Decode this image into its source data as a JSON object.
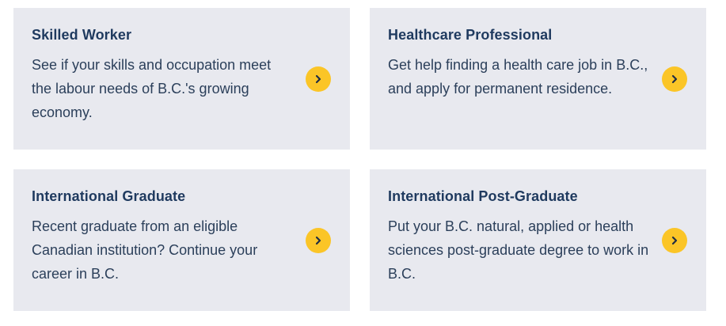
{
  "pathways": [
    {
      "title": "Skilled Worker",
      "description": "See if your skills and occupation meet the labour needs of B.C.'s growing economy.",
      "arrow_icon": "chevron-right-icon"
    },
    {
      "title": "Healthcare Professional",
      "description": "Get help finding a health care job in B.C., and apply for permanent residence.",
      "arrow_icon": "chevron-right-icon"
    },
    {
      "title": "International Graduate",
      "description": "Recent graduate from an eligible Canadian institution? Continue your career in B.C.",
      "arrow_icon": "chevron-right-icon"
    },
    {
      "title": "International Post-Graduate",
      "description": "Put your B.C. natural, applied or health sciences post-graduate degree to work in B.C.",
      "arrow_icon": "chevron-right-icon"
    }
  ],
  "colors": {
    "card_background": "#e8e9ef",
    "title": "#1f3a5f",
    "text": "#2b3f5a",
    "arrow_background": "#fbc527",
    "arrow_glyph": "#1f2d44"
  }
}
